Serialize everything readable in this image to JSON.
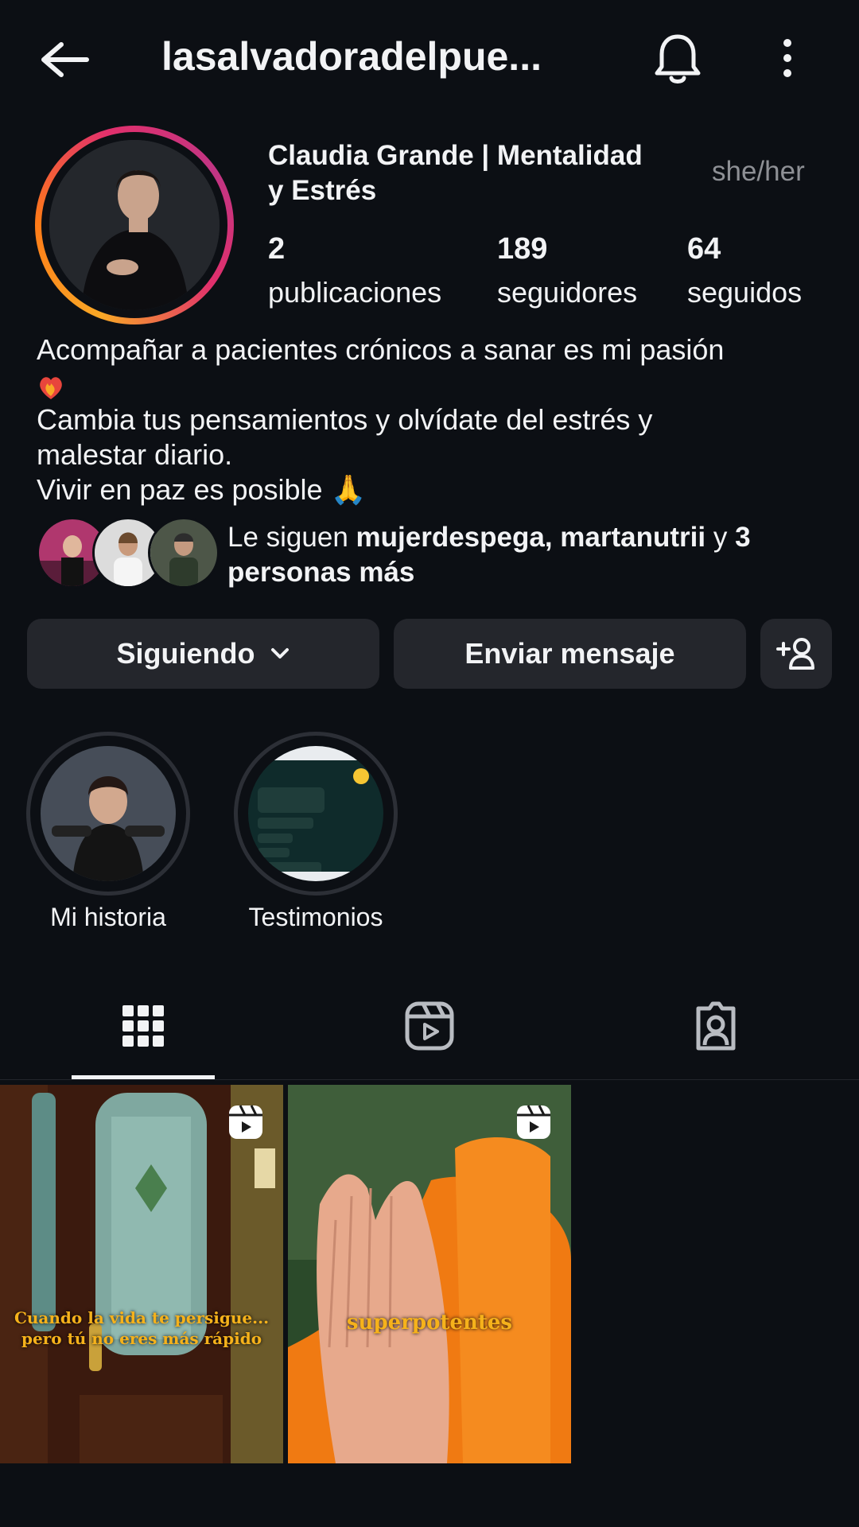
{
  "header": {
    "username": "lasalvadoradelpue...",
    "back_icon": "arrow-left-icon",
    "bell_icon": "bell-icon",
    "more_icon": "more-vertical-icon"
  },
  "profile": {
    "name_line1": "Claudia Grande | Mentalidad",
    "name_line2": "y Estrés",
    "pronouns": "she/her",
    "stats": [
      {
        "value": "2",
        "label": "publicaciones"
      },
      {
        "value": "189",
        "label": "seguidores"
      },
      {
        "value": "64",
        "label": "seguidos"
      }
    ],
    "bio": [
      "Acompañar a pacientes crónicos a sanar es mi pasión",
      "Cambia tus pensamientos y olvídate del estrés y",
      "malestar diario.",
      "Vivir en paz es posible 🙏"
    ],
    "followed_by_prefix": "Le siguen ",
    "followed_by_user1": "mujerdespega",
    "followed_by_sep": ", ",
    "followed_by_user2": "martanutrii",
    "followed_by_mid": " y ",
    "followed_by_rest": "3 personas más"
  },
  "actions": {
    "following_label": "Siguiendo",
    "message_label": "Enviar mensaje",
    "add_icon": "add-person-icon"
  },
  "highlights": [
    {
      "label": "Mi historia"
    },
    {
      "label": "Testimonios"
    }
  ],
  "tabs": [
    "grid-icon",
    "reels-icon",
    "tagged-icon"
  ],
  "posts": [
    {
      "caption_line1": "Cuando la vida te persigue...",
      "caption_line2": "pero tú no eres más rápido"
    },
    {
      "caption_line1": "superpotentes"
    }
  ],
  "colors": {
    "background": "#0c0f14",
    "button": "#24262c",
    "caption": "#f6b21b"
  }
}
